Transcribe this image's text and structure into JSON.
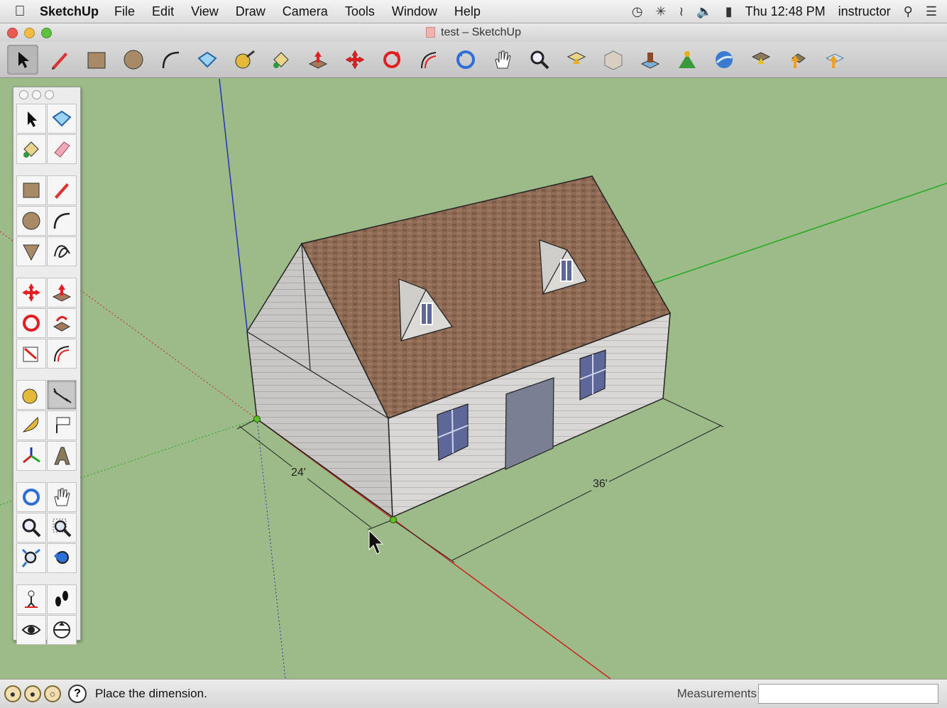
{
  "menubar": {
    "app": "SketchUp",
    "items": [
      "File",
      "Edit",
      "View",
      "Draw",
      "Camera",
      "Tools",
      "Window",
      "Help"
    ],
    "clock": "Thu 12:48 PM",
    "user": "instructor"
  },
  "window": {
    "title": "test – SketchUp"
  },
  "viewport": {
    "dim_width": "24'",
    "dim_length": "36'"
  },
  "statusbar": {
    "hint": "Place the dimension.",
    "measurements_label": "Measurements",
    "measurements_value": ""
  },
  "colors": {
    "ground": "#9dbb88",
    "roof": "#8e6b55",
    "siding": "#d8d6d4",
    "door": "#7b7f94",
    "window": "#5d6898",
    "axis_red": "#cc2222",
    "axis_green": "#22aa22",
    "axis_blue": "#2233bb"
  }
}
